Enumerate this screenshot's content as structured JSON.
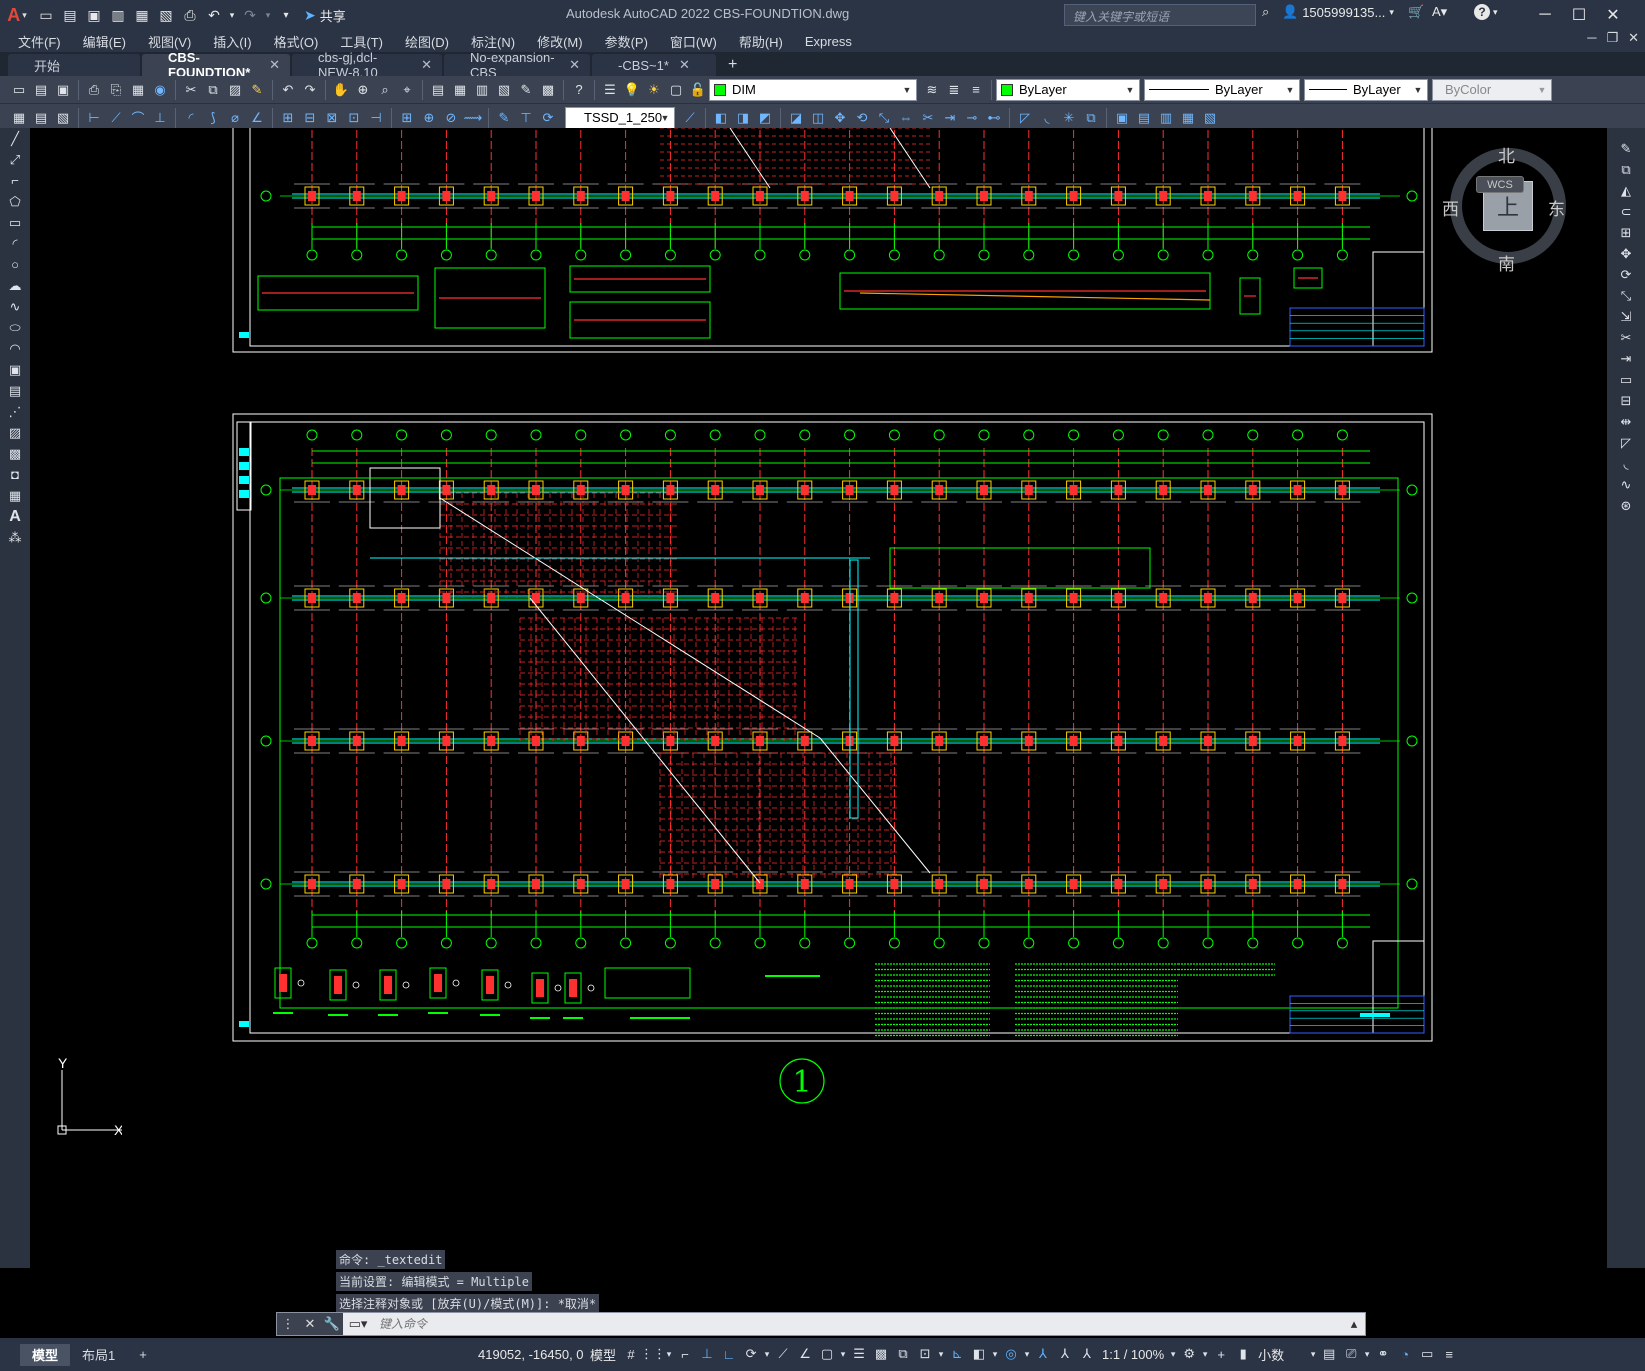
{
  "app": {
    "title": "Autodesk AutoCAD 2022    CBS-FOUNDTION.dwg",
    "logo": "A",
    "share_label": "共享",
    "search_placeholder": "键入关键字或短语",
    "user": "1505999135...",
    "help": "?"
  },
  "menu": [
    "文件(F)",
    "编辑(E)",
    "视图(V)",
    "插入(I)",
    "格式(O)",
    "工具(T)",
    "绘图(D)",
    "标注(N)",
    "修改(M)",
    "参数(P)",
    "窗口(W)",
    "帮助(H)",
    "Express"
  ],
  "tabs": [
    {
      "label": "开始",
      "closable": false,
      "active": false
    },
    {
      "label": "CBS-FOUNDTION*",
      "closable": true,
      "active": true
    },
    {
      "label": "cbs-gj,dcl-NEW-8,10",
      "closable": true,
      "active": false
    },
    {
      "label": "No-expansion-CBS",
      "closable": true,
      "active": false
    },
    {
      "label": "-CBS~1*",
      "closable": true,
      "active": false
    }
  ],
  "toolbar": {
    "layer_name": "DIM",
    "layer_color": "#00ff00",
    "color_value": "ByLayer",
    "linetype_value": "ByLayer",
    "lineweight_value": "ByLayer",
    "plotstyle_value": "ByColor",
    "text_style": "TSSD_1_250"
  },
  "viewcube": {
    "north": "北",
    "south": "南",
    "east": "东",
    "west": "西",
    "top": "上",
    "wcs": "WCS"
  },
  "drawing": {
    "sheet_number": "1",
    "ucs_x": "X",
    "ucs_y": "Y",
    "colors": {
      "grid": "#00ff00",
      "column": "#ff3030",
      "beam": "#00ffff",
      "frame": "#ffffff",
      "pad": "#ffd200"
    }
  },
  "command": {
    "history": [
      "命令: _textedit",
      "当前设置: 编辑模式 = Multiple",
      "选择注释对象或 [放弃(U)/模式(M)]: *取消*"
    ],
    "placeholder": "键入命令"
  },
  "status": {
    "layout_tabs": [
      "模型",
      "布局1"
    ],
    "coords": "419052, -16450, 0",
    "model_label": "模型",
    "scale": "1:1 / 100%",
    "units": "小数"
  }
}
